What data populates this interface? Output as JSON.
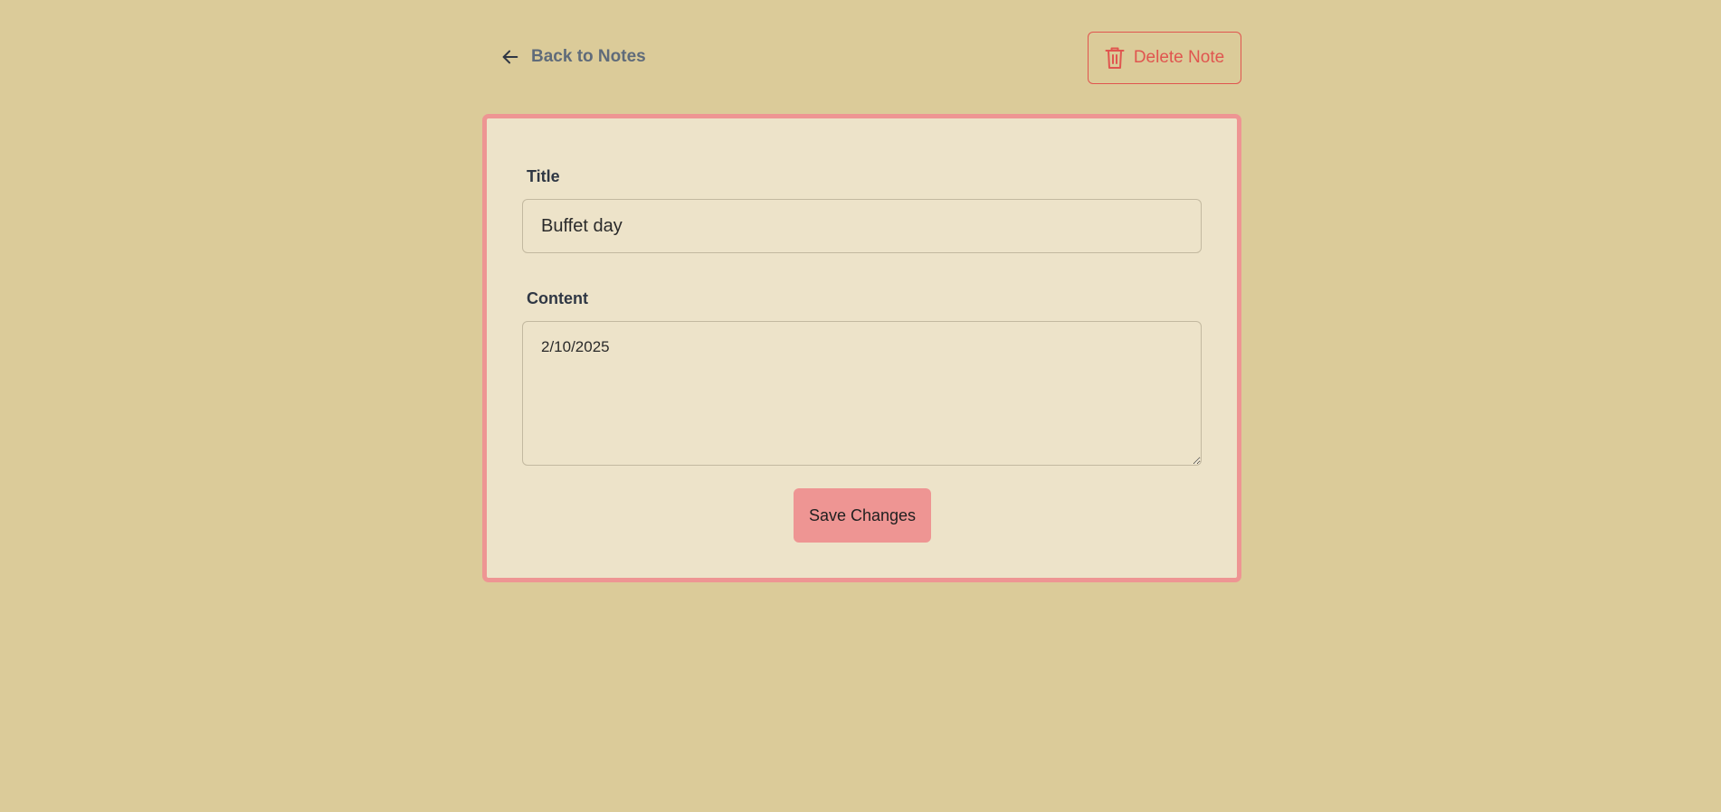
{
  "nav": {
    "back_label": "Back to Notes",
    "back_icon": "arrow-left-icon"
  },
  "toolbar": {
    "delete_label": "Delete Note",
    "delete_icon": "trash-icon"
  },
  "form": {
    "title_label": "Title",
    "title_value": "Buffet day",
    "content_label": "Content",
    "content_value": "2/10/2025",
    "save_label": "Save Changes"
  },
  "colors": {
    "page_background": "#dbcb99",
    "card_background": "#ede3c9",
    "accent": "#ee9593",
    "danger": "#e0554f",
    "muted_text": "#5f6b7a"
  }
}
